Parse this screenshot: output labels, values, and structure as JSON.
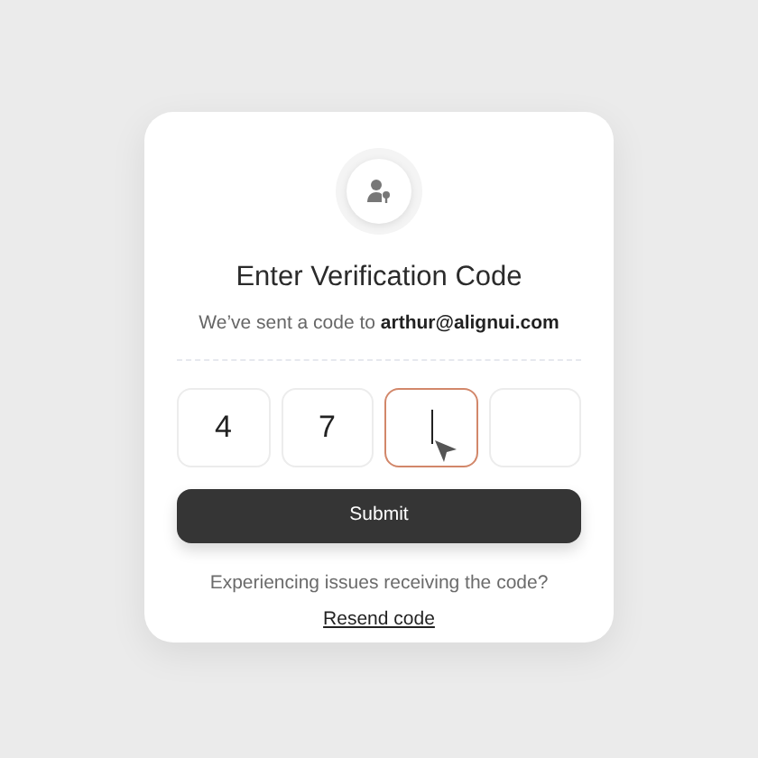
{
  "title": "Enter Verification Code",
  "subtitle": "We’ve sent a code to **arthur@alignui.com**",
  "code_digits": [
    {
      "value": "4",
      "focused": false
    },
    {
      "value": "7",
      "focused": false
    },
    {
      "focused": true
    },
    {
      "focused": false
    }
  ],
  "submit_button": "Submit",
  "help_text": "Experiencing issues receiving the code?",
  "resend_link": "Resend code"
}
